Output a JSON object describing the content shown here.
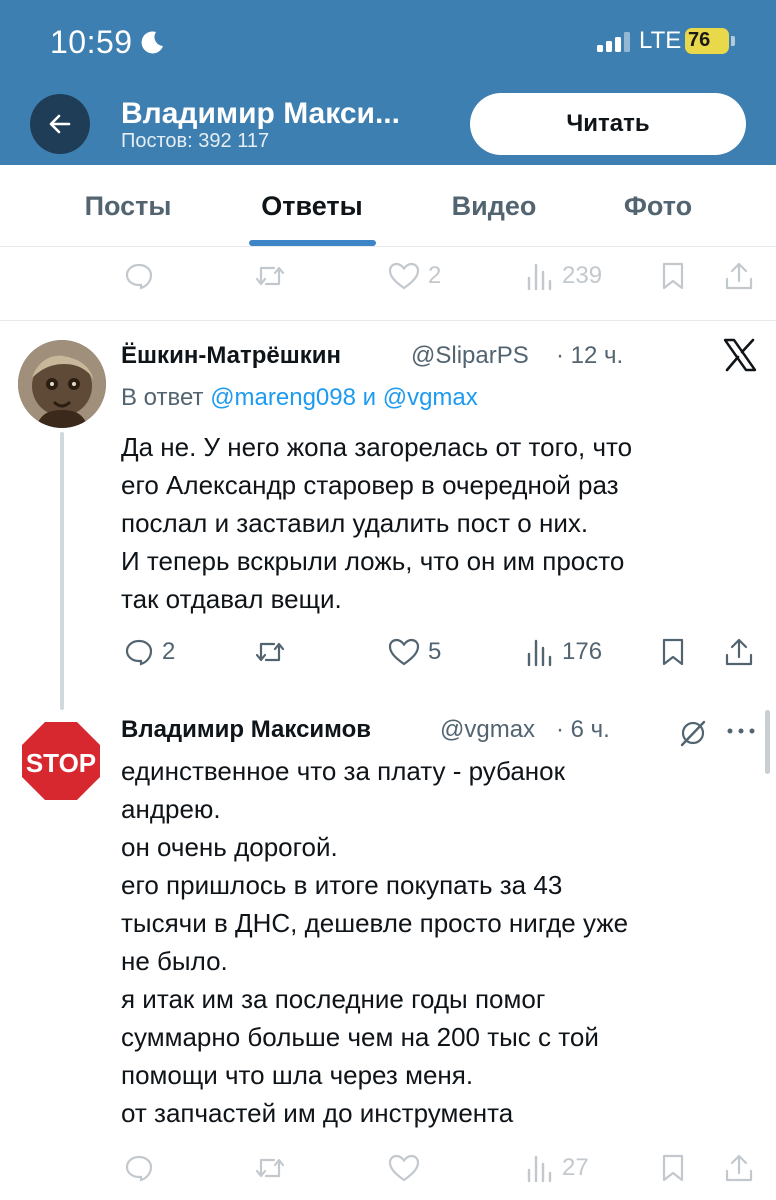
{
  "status_bar": {
    "time": "10:59",
    "network": "LTE",
    "battery": "76"
  },
  "header": {
    "title": "Владимир Макси...",
    "posts_count": "Постов: 392 117",
    "read_button": "Читать"
  },
  "tabs": [
    {
      "label": "Посты"
    },
    {
      "label": "Ответы"
    },
    {
      "label": "Видео"
    },
    {
      "label": "Фото"
    }
  ],
  "prev_tweet_actions": {
    "likes": "2",
    "views": "239"
  },
  "tweets": [
    {
      "author": "Ёшкин-Матрёшкин",
      "handle": "@SliparPS",
      "time": "· 12 ч.",
      "reply_prefix": "В ответ",
      "reply_to_1": "@mareng098",
      "reply_and": "и",
      "reply_to_2": "@vgmax",
      "text": "Да не. У него жопа загорелась от того, что\nего Александр старовер в очередной раз\nпослал и заставил удалить пост о них.\nИ теперь вскрыли ложь, что он им просто\nтак отдавал вещи.",
      "replies": "2",
      "likes": "5",
      "views": "176"
    },
    {
      "author": "Владимир Максимов",
      "handle": "@vgmax",
      "time": "· 6 ч.",
      "avatar_text": "STOP",
      "text": "единственное что за плату - рубанок\nандрею.\nон очень дорогой.\nего пришлось в итоге покупать за 43\nтысячи в ДНС, дешевле просто нигде уже\nне было.\nя итак им за последние годы помог\nсуммарно больше чем на 200 тыс с той\nпомощи что шла через меня.\n от запчастей им до инструмента",
      "views": "27"
    }
  ],
  "icons": {
    "back": "arrow-left-icon",
    "reply": "speech-bubble-icon",
    "retweet": "retweet-icon",
    "like": "heart-icon",
    "views": "bar-chart-icon",
    "bookmark": "bookmark-icon",
    "share": "share-icon",
    "x_logo": "x-logo-icon",
    "grok": "grok-icon",
    "more": "ellipsis-icon"
  },
  "colors": {
    "header_bg": "#3d7fb0",
    "link": "#1d9bf0",
    "tab_underline": "#3d85c6",
    "stop_red": "#d7282f"
  }
}
